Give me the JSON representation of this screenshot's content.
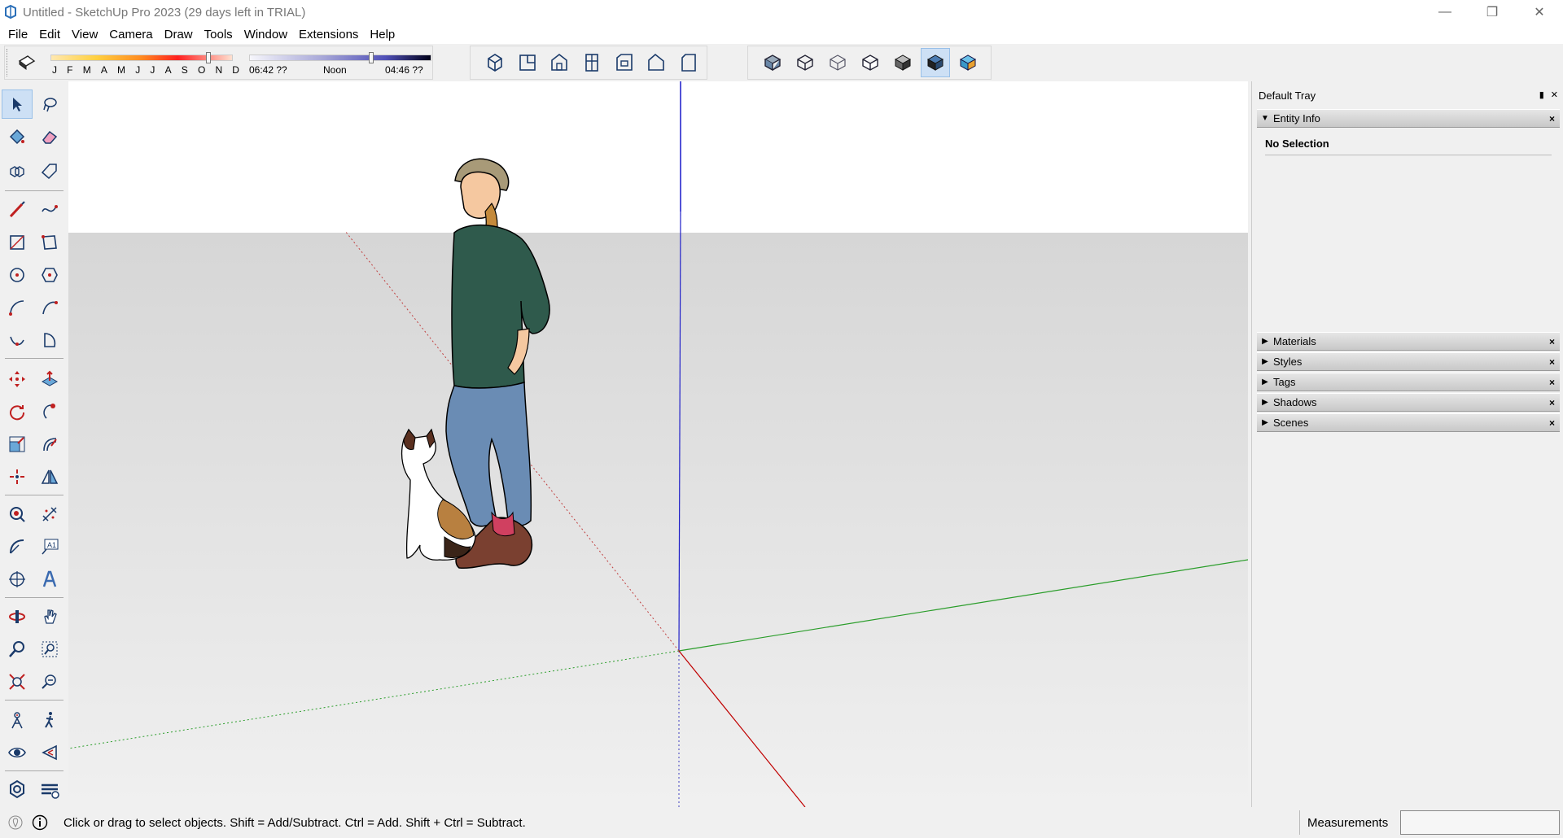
{
  "window": {
    "title": "Untitled - SketchUp Pro 2023 (29 days left in TRIAL)"
  },
  "menu": [
    "File",
    "Edit",
    "View",
    "Camera",
    "Draw",
    "Tools",
    "Window",
    "Extensions",
    "Help"
  ],
  "shadows": {
    "months": [
      "J",
      "F",
      "M",
      "A",
      "M",
      "J",
      "J",
      "A",
      "S",
      "O",
      "N",
      "D"
    ],
    "sunrise": "06:42 ??",
    "noon": "Noon",
    "sunset": "04:46 ??"
  },
  "tray": {
    "title": "Default Tray",
    "entity_info": {
      "label": "Entity Info",
      "status": "No Selection"
    },
    "panels": [
      "Materials",
      "Styles",
      "Tags",
      "Shadows",
      "Scenes"
    ]
  },
  "status": {
    "message": "Click or drag to select objects. Shift = Add/Subtract. Ctrl = Add. Shift + Ctrl = Subtract.",
    "measurements_label": "Measurements",
    "measurements_value": ""
  },
  "colors": {
    "accent": "#cde0f5",
    "axis_red": "#c00000",
    "axis_green": "#2a9d2a",
    "axis_blue": "#1818c8"
  }
}
